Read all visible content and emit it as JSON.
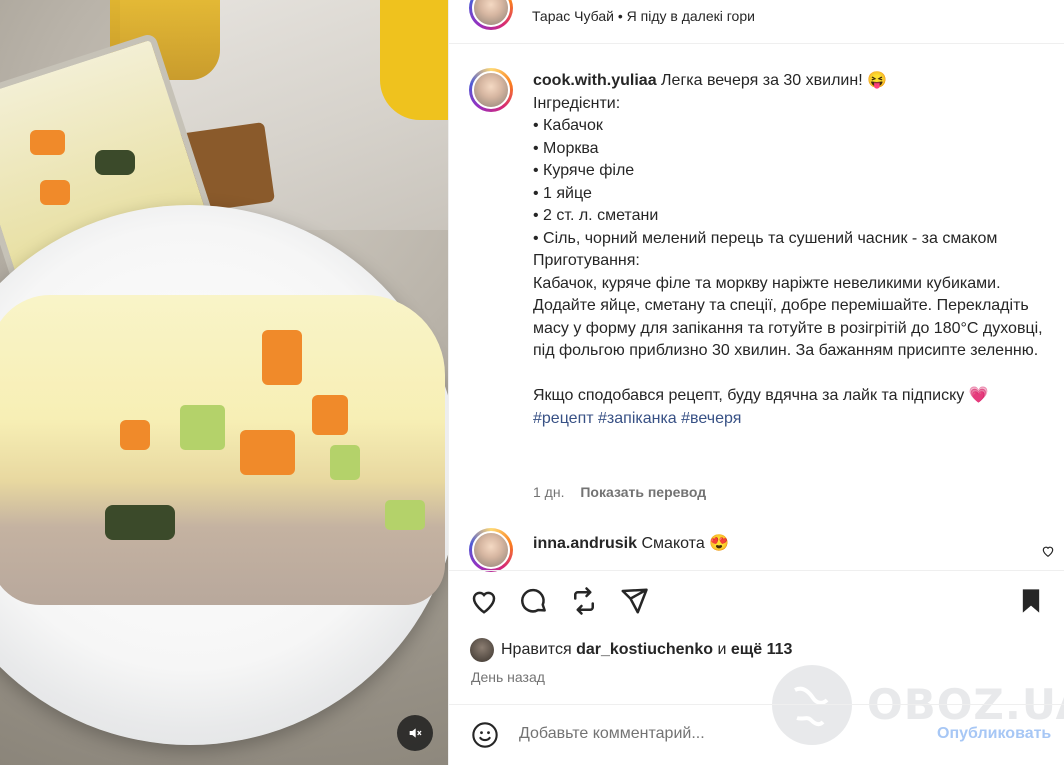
{
  "header": {
    "line": "Тарас Чубай • Я піду в далекі гори"
  },
  "caption": {
    "username": "cook.with.yuliaa",
    "title": "Легка вечеря за 30 хвилин! 😝",
    "lines": [
      "Інгредієнти:",
      "• Кабачок",
      "• Морква",
      "• Куряче філе",
      "• 1 яйце",
      "• 2 ст. л. сметани",
      "• Сіль, чорний мелений перець та сушений часник - за смаком",
      "Приготування:",
      "Кабачок, куряче філе та моркву наріжте невеликими кубиками. Додайте яйце, сметану та спеції, добре перемішайте. Перекладіть масу у форму для запікання та готуйте в розігрітій до 180°C духовці, під фольгою приблизно 30 хвилин. За бажанням присипте зеленню.",
      "",
      "Якщо сподобався рецепт, буду вдячна за лайк та підписку 💗"
    ],
    "tags": "#рецепт #запіканка #вечеря",
    "age": "1 дн.",
    "translate": "Показать перевод"
  },
  "comment": {
    "username": "inna.andrusik",
    "text": "Смакота 😍"
  },
  "likes": {
    "prefix": "Нравится",
    "user": "dar_kostiuchenko",
    "and": "и",
    "more": "ещё 113"
  },
  "time": "День назад",
  "add_comment": {
    "placeholder": "Добавьте комментарий...",
    "publish": "Опубликовать"
  },
  "watermark": "OBOZ.UA",
  "icons": [
    "heart-icon",
    "comment-icon",
    "repost-icon",
    "share-icon",
    "bookmark-icon",
    "mute-icon",
    "emoji-icon"
  ]
}
